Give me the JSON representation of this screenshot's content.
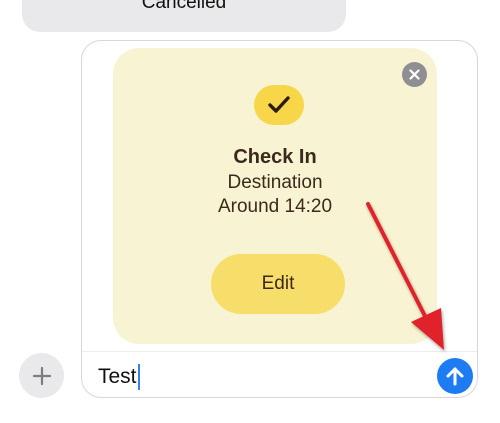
{
  "previous_message": {
    "text": "Cancelled"
  },
  "checkin_card": {
    "title": "Check In",
    "destination": "Destination",
    "time": "Around 14:20",
    "edit_label": "Edit",
    "badge_icon": "checkmark-icon",
    "remove_icon": "close-icon"
  },
  "composer": {
    "text_value": "Test",
    "plus_icon": "plus-icon",
    "send_icon": "arrow-up-icon"
  },
  "colors": {
    "card_background": "#f8f4d3",
    "badge": "#f7d64a",
    "edit_button": "#f7de6a",
    "send_button": "#1e7cf2",
    "annotation_arrow": "#e0232b"
  }
}
